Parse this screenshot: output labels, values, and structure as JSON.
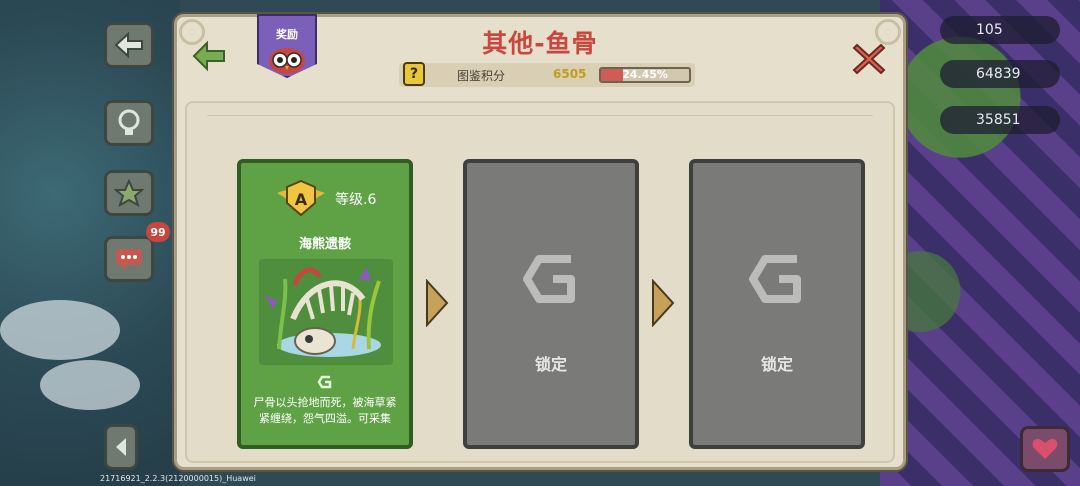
{
  "panel": {
    "title": "其他-鱼骨",
    "reward_tab_label": "奖励",
    "score_label": "图鉴积分",
    "score_value": "6505",
    "progress_text": "24.45%",
    "progress_fraction": 0.2445
  },
  "cards": [
    {
      "state": "unlocked",
      "level": "等级.6",
      "rank_letter": "A",
      "name": "海熊遗骸",
      "description": "尸骨以头抢地而死，被海草紧紧缠绕，怨气四溢。可采集"
    },
    {
      "state": "locked",
      "label": "锁定"
    },
    {
      "state": "locked",
      "label": "锁定"
    }
  ],
  "hud": {
    "chat_badge": "99",
    "res_gems": "105",
    "res_coins": "64839",
    "res_blue": "35851"
  },
  "version_text": "21716921_2.2.3(2120000015)_Huawei",
  "colors": {
    "title_red": "#c8473f",
    "card_green": "#5fa246",
    "card_locked": "#7a7a78",
    "progress_fill": "#cf5c56"
  }
}
